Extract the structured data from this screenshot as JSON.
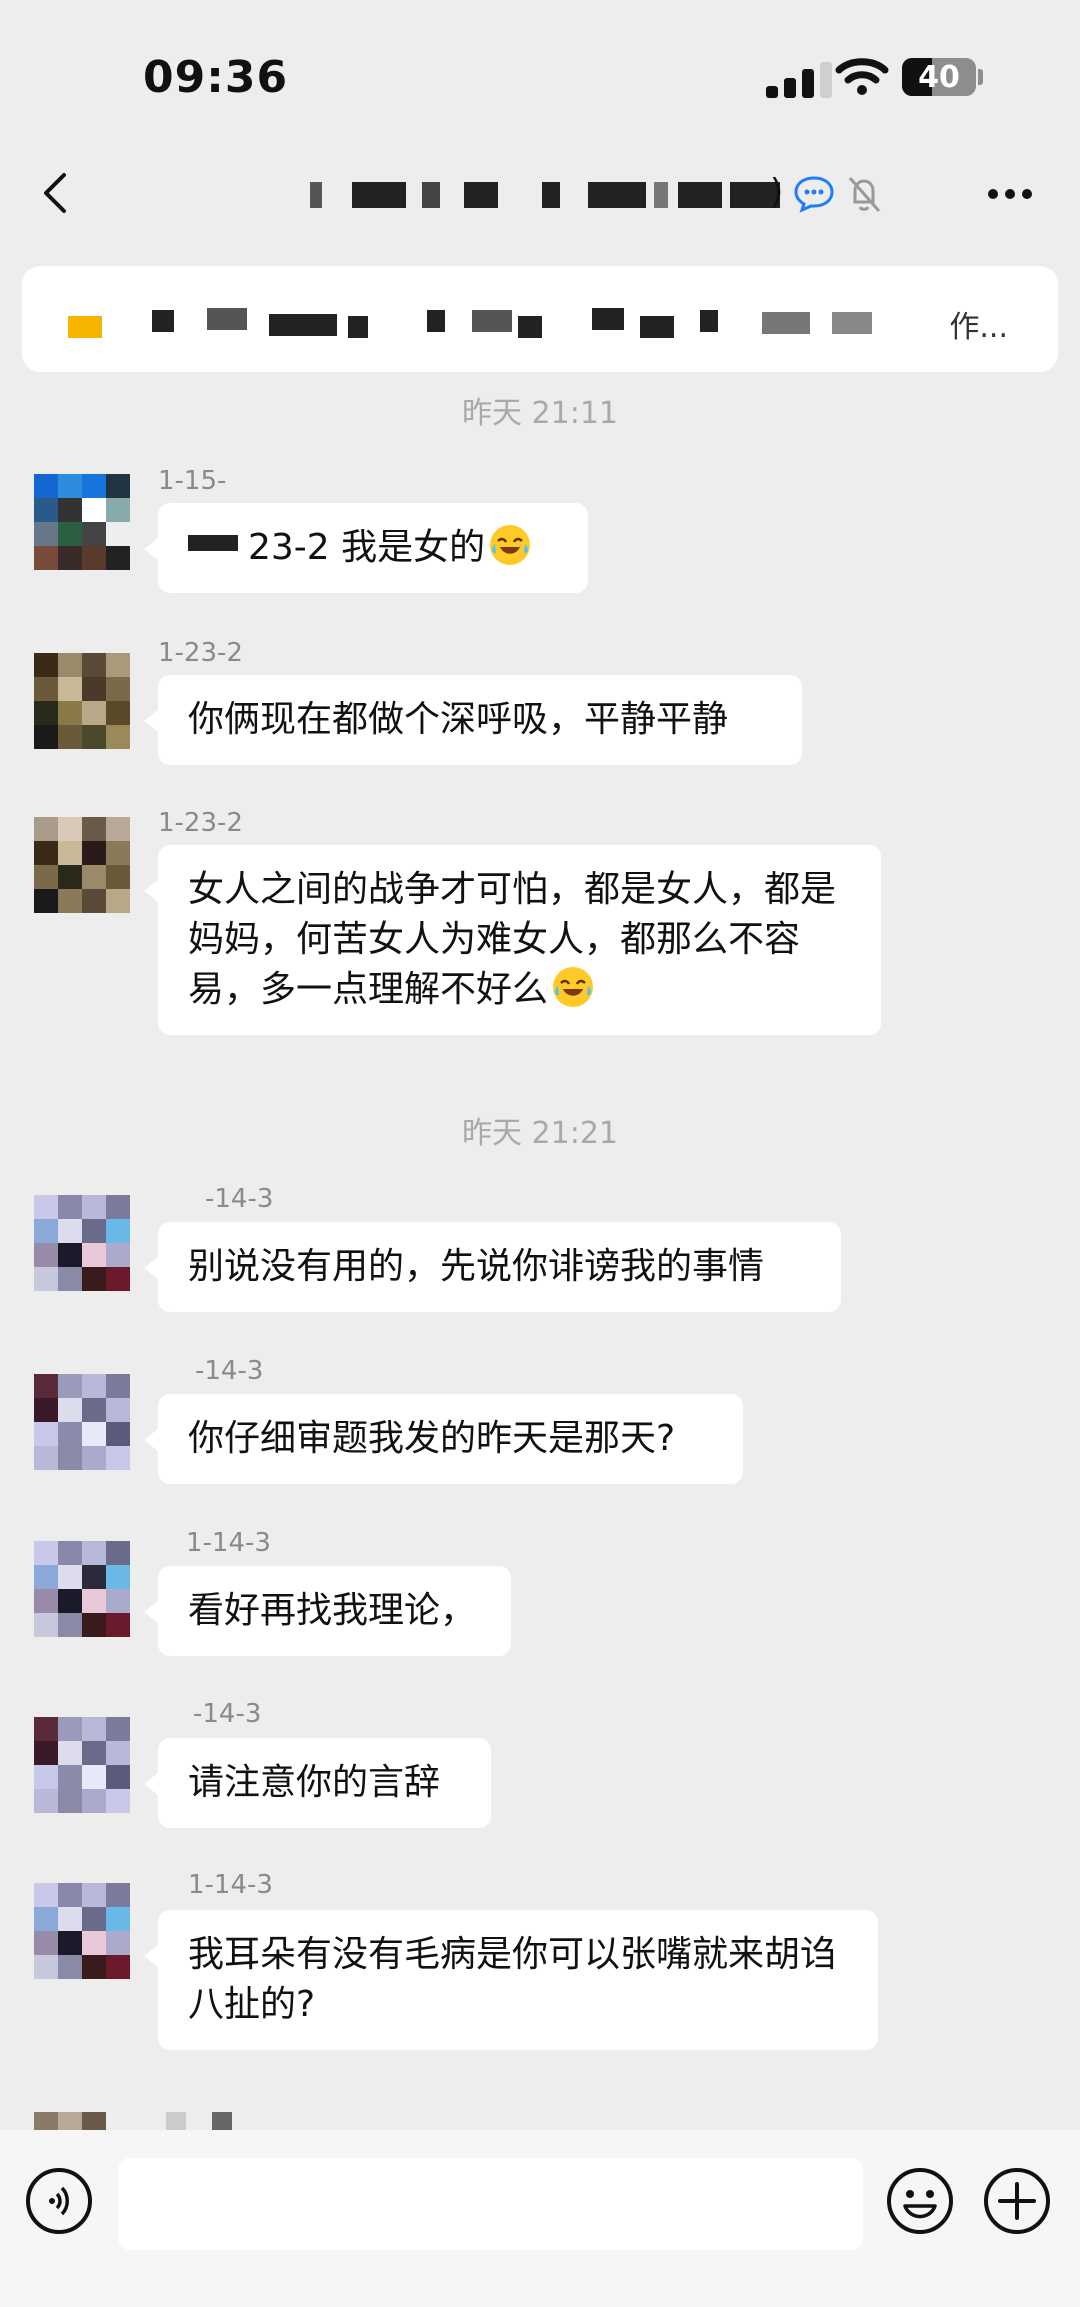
{
  "status": {
    "time": "09:36",
    "battery": "40",
    "battery_level": 0.4
  },
  "nav": {
    "title_suffix": ")",
    "back_icon": "chevron-left-icon",
    "more_icon": "more-icon"
  },
  "pinned": {
    "tail": "作..."
  },
  "messages": [
    {
      "sender": "1-15-",
      "text": "23-2 我是女的",
      "emoji": true
    },
    {
      "sender": "1-23-2",
      "text": "你俩现在都做个深呼吸，平静平静",
      "emoji": false
    },
    {
      "sender": "1-23-2",
      "text": "女人之间的战争才可怕，都是女人，都是妈妈，何苦女人为难女人，都那么不容易，多一点理解不好么",
      "emoji": true
    },
    {
      "sender": "-14-3",
      "text": "别说没有用的，先说你诽谤我的事情",
      "emoji": false
    },
    {
      "sender": "-14-3",
      "text": "你仔细审题我发的昨天是那天?",
      "emoji": false
    },
    {
      "sender": "1-14-3",
      "text": "看好再找我理论，",
      "emoji": false
    },
    {
      "sender": "-14-3",
      "text": "请注意你的言辞",
      "emoji": false
    },
    {
      "sender": "1-14-3",
      "text": "我耳朵有没有毛病是你可以张嘴就来胡诌八扯的?",
      "emoji": false
    }
  ],
  "timestamps": [
    "昨天 21:11",
    "昨天 21:21"
  ],
  "colors": {
    "background": "#ededed",
    "bubble": "#ffffff",
    "timestamp": "#a9a9a9",
    "accent": "#1f7cff"
  }
}
